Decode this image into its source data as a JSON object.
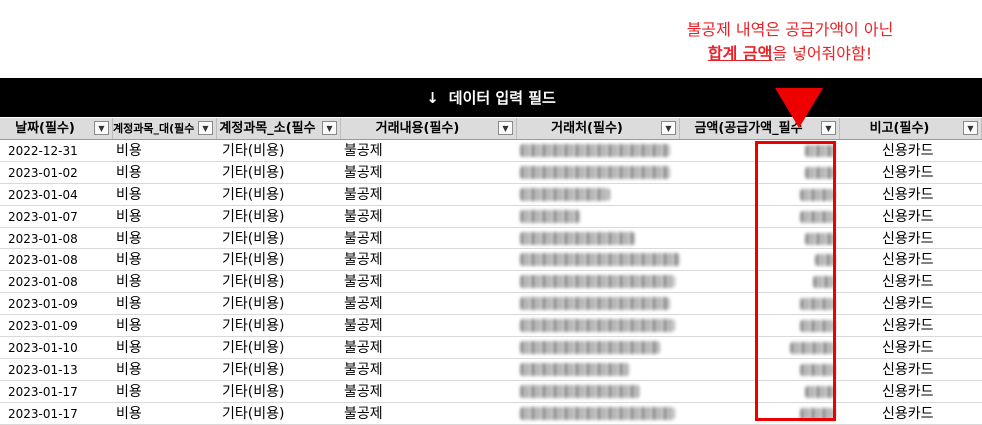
{
  "annotation": {
    "line1": "불공제 내역은 공급가액이 아닌",
    "line2_bold": "합계 금액",
    "line2_rest": "을 넣어줘야함!"
  },
  "banner": {
    "arrow": "↓",
    "label": "데이터 입력 필드"
  },
  "headers": [
    "날짜(필수)",
    "계정과목_대(필수",
    "계정과목_소(필수",
    "거래내용(필수)",
    "거래처(필수)",
    "금액(공급가액_필수",
    "비고(필수)"
  ],
  "rows": [
    {
      "date": "2022-12-31",
      "cat1": "비용",
      "cat2": "기타(비용)",
      "desc": "불공제",
      "memo": "신용카드"
    },
    {
      "date": "2023-01-02",
      "cat1": "비용",
      "cat2": "기타(비용)",
      "desc": "불공제",
      "memo": "신용카드"
    },
    {
      "date": "2023-01-04",
      "cat1": "비용",
      "cat2": "기타(비용)",
      "desc": "불공제",
      "memo": "신용카드"
    },
    {
      "date": "2023-01-07",
      "cat1": "비용",
      "cat2": "기타(비용)",
      "desc": "불공제",
      "memo": "신용카드"
    },
    {
      "date": "2023-01-08",
      "cat1": "비용",
      "cat2": "기타(비용)",
      "desc": "불공제",
      "memo": "신용카드"
    },
    {
      "date": "2023-01-08",
      "cat1": "비용",
      "cat2": "기타(비용)",
      "desc": "불공제",
      "memo": "신용카드"
    },
    {
      "date": "2023-01-08",
      "cat1": "비용",
      "cat2": "기타(비용)",
      "desc": "불공제",
      "memo": "신용카드"
    },
    {
      "date": "2023-01-09",
      "cat1": "비용",
      "cat2": "기타(비용)",
      "desc": "불공제",
      "memo": "신용카드"
    },
    {
      "date": "2023-01-09",
      "cat1": "비용",
      "cat2": "기타(비용)",
      "desc": "불공제",
      "memo": "신용카드"
    },
    {
      "date": "2023-01-10",
      "cat1": "비용",
      "cat2": "기타(비용)",
      "desc": "불공제",
      "memo": "신용카드"
    },
    {
      "date": "2023-01-13",
      "cat1": "비용",
      "cat2": "기타(비용)",
      "desc": "불공제",
      "memo": "신용카드"
    },
    {
      "date": "2023-01-17",
      "cat1": "비용",
      "cat2": "기타(비용)",
      "desc": "불공제",
      "memo": "신용카드"
    },
    {
      "date": "2023-01-17",
      "cat1": "비용",
      "cat2": "기타(비용)",
      "desc": "불공제",
      "memo": "신용카드"
    }
  ],
  "colors": {
    "annotation": "#e8242a",
    "highlight": "#ee0000",
    "banner_bg": "#000000",
    "header_bg": "#dcdcdc"
  },
  "icons": {
    "filter_dropdown": "chevron-down-icon",
    "filter_active": "filter-icon",
    "banner_arrow": "arrow-down-icon",
    "pointer": "triangle-down-icon"
  }
}
